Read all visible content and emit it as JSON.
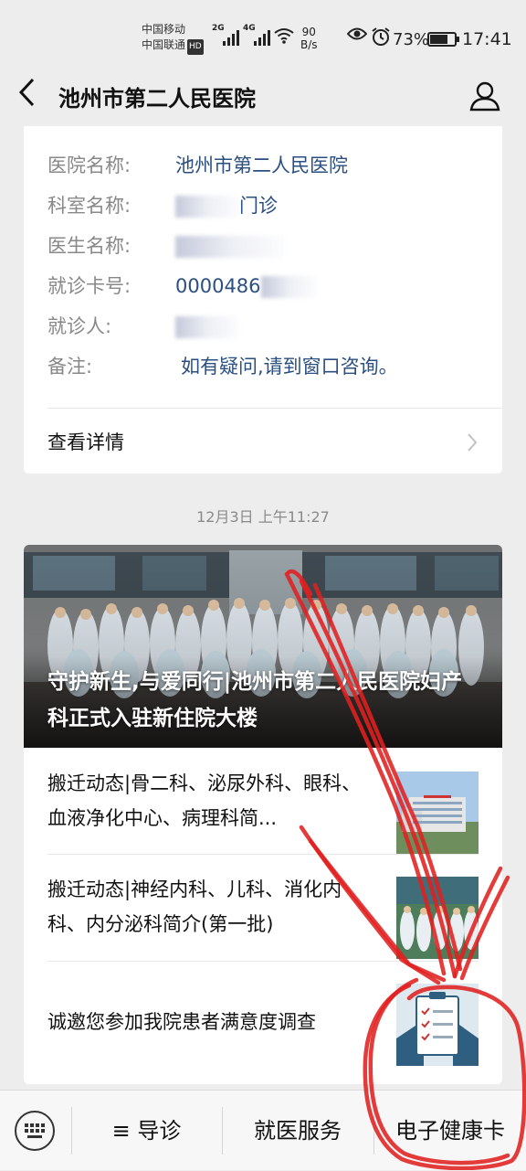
{
  "status_bar": {
    "carrier_1": "中国移动",
    "carrier_2": "中国联通",
    "hd_badge": "HD",
    "network_1": "2G",
    "network_2": "4G",
    "speed_value": "90",
    "speed_unit": "B/s",
    "battery_percent": "73%",
    "battery_level": 0.73,
    "time": "17:41"
  },
  "nav": {
    "title": "池州市第二人民医院",
    "back_icon": "chevron-left-icon",
    "profile_icon": "user-icon"
  },
  "appointment_card": {
    "rows": [
      {
        "label": "医院名称:",
        "value": "池州市第二人民医院"
      },
      {
        "label": "科室名称:",
        "value": "门诊"
      },
      {
        "label": "医生名称:",
        "value": ""
      },
      {
        "label": "就诊卡号:",
        "value": "0000486"
      },
      {
        "label": "就诊人:",
        "value": ""
      },
      {
        "label": "备注:",
        "value": "如有疑问,请到窗口咨询。"
      }
    ],
    "detail_link": "查看详情"
  },
  "timestamp": "12月3日 上午11:27",
  "articles": {
    "hero_title": "守护新生,与爱同行|池州市第二人民医院妇产科正式入驻新住院大楼",
    "items": [
      {
        "title": "搬迁动态|骨二科、泌尿外科、眼科、血液净化中心、病理科简..."
      },
      {
        "title": "搬迁动态|神经内科、儿科、消化内科、内分泌科简介(第一批)"
      },
      {
        "title": "诚邀您参加我院患者满意度调查"
      }
    ]
  },
  "tab_bar": {
    "keyboard_icon": "keyboard-icon",
    "tabs": [
      "≡ 导诊",
      "就医服务",
      "电子健康卡"
    ]
  },
  "colors": {
    "background": "#ededed",
    "link_blue": "#2a4f80",
    "label_gray": "#888888",
    "annotation_red": "#e02020"
  }
}
